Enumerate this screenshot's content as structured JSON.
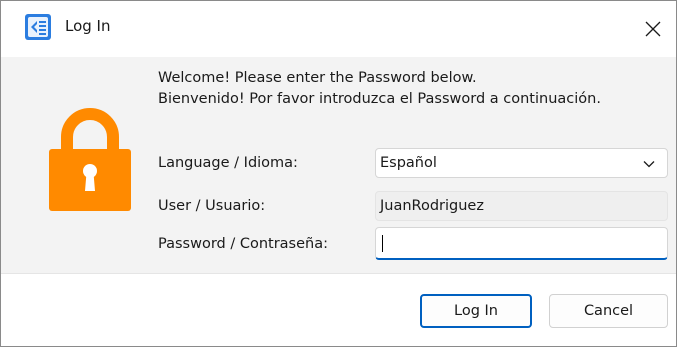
{
  "window": {
    "title": "Log In",
    "app_icon": "app-logo-icon",
    "close_icon": "close-icon"
  },
  "content": {
    "lock_icon": "lock-icon",
    "lock_color": "#ff8a00",
    "welcome_line1": "Welcome! Please enter the Password below.",
    "welcome_line2": "Bienvenido! Por favor introduzca el Password a continuación."
  },
  "form": {
    "language_label": "Language / Idioma:",
    "language_value": "Español",
    "user_label": "User / Usuario:",
    "user_value": "JuanRodriguez",
    "password_label": "Password / Contraseña:",
    "password_value": ""
  },
  "buttons": {
    "login_label": "Log In",
    "cancel_label": "Cancel",
    "accent": "#0060c0"
  }
}
